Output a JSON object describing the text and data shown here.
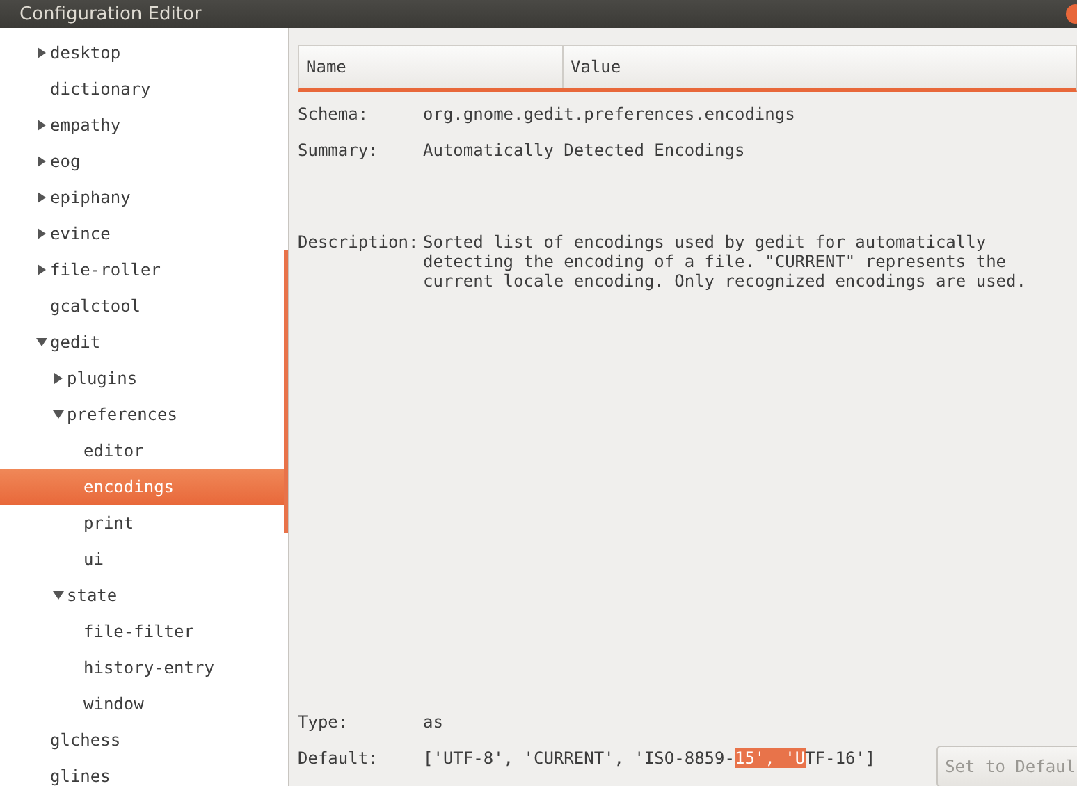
{
  "window": {
    "title": "Configuration Editor"
  },
  "tree": [
    {
      "label": "desktop",
      "expanded": false,
      "selected": false
    },
    {
      "label": "dictionary",
      "selected": false
    },
    {
      "label": "empathy",
      "expanded": false,
      "selected": false
    },
    {
      "label": "eog",
      "expanded": false,
      "selected": false
    },
    {
      "label": "epiphany",
      "expanded": false,
      "selected": false
    },
    {
      "label": "evince",
      "expanded": false,
      "selected": false
    },
    {
      "label": "file-roller",
      "expanded": false,
      "selected": false
    },
    {
      "label": "gcalctool",
      "selected": false
    },
    {
      "label": "gedit",
      "expanded": true,
      "selected": false,
      "children": [
        {
          "label": "plugins",
          "expanded": false,
          "selected": false
        },
        {
          "label": "preferences",
          "expanded": true,
          "selected": false,
          "children": [
            {
              "label": "editor",
              "selected": false
            },
            {
              "label": "encodings",
              "selected": true
            },
            {
              "label": "print",
              "selected": false
            },
            {
              "label": "ui",
              "selected": false
            }
          ]
        },
        {
          "label": "state",
          "expanded": true,
          "selected": false,
          "children": [
            {
              "label": "file-filter",
              "selected": false
            },
            {
              "label": "history-entry",
              "selected": false
            },
            {
              "label": "window",
              "selected": false
            }
          ]
        }
      ]
    },
    {
      "label": "glchess",
      "selected": false
    },
    {
      "label": "glines",
      "selected": false
    }
  ],
  "table": {
    "columns": [
      "Name",
      "Value"
    ]
  },
  "details": {
    "schema_label": "Schema:",
    "schema": "org.gnome.gedit.preferences.encodings",
    "summary_label": "Summary:",
    "summary": "Automatically Detected Encodings",
    "description_label": "Description:",
    "description": "Sorted list of encodings used by gedit for automatically detecting the encoding of a file. \"CURRENT\" represents the current locale encoding. Only recognized encodings are used.",
    "type_label": "Type:",
    "type": "as",
    "default_label": "Default:",
    "default": {
      "before": "['UTF-8', 'CURRENT', 'ISO-8859-",
      "selected_text": "15', 'U",
      "after": "TF-16']"
    }
  },
  "buttons": [
    {
      "label": "Set to Defaul",
      "disabled": true
    }
  ]
}
